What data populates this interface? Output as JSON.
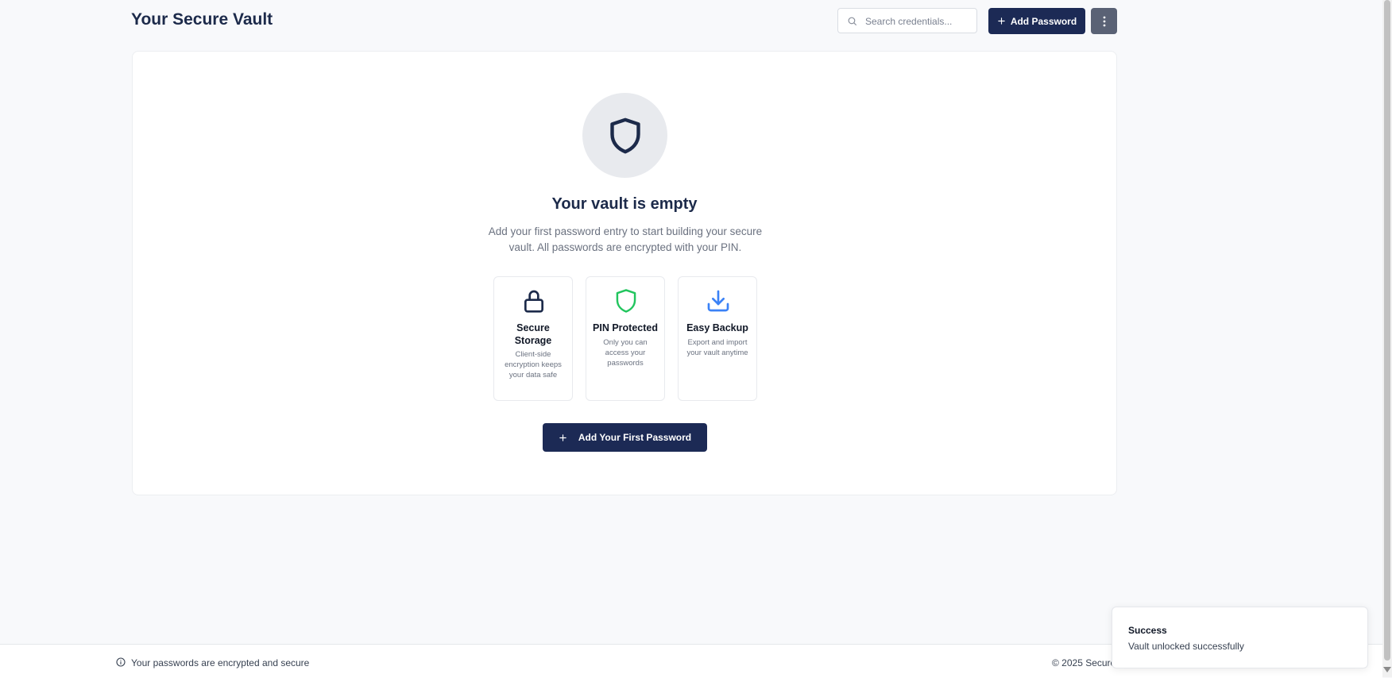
{
  "header": {
    "title": "Your Secure Vault",
    "search_placeholder": "Search credentials...",
    "add_button_label": "Add Password",
    "more_icon": "more-vertical-icon"
  },
  "empty_state": {
    "icon": "shield-icon",
    "title": "Your vault is empty",
    "description": "Add your first password entry to start building your secure vault. All passwords are encrypted with your PIN.",
    "features": [
      {
        "icon": "lock-icon",
        "color": "#1c2a4a",
        "title": "Secure Storage",
        "description": "Client-side encryption keeps your data safe"
      },
      {
        "icon": "shield-icon",
        "color": "#22c55e",
        "title": "PIN Protected",
        "description": "Only you can access your passwords"
      },
      {
        "icon": "download-icon",
        "color": "#3b82f6",
        "title": "Easy Backup",
        "description": "Export and import your vault anytime"
      }
    ],
    "cta_label": "Add Your First Password"
  },
  "footer": {
    "info_icon": "info-icon",
    "security_text": "Your passwords are encrypted and secure",
    "copyright": "© 2025 Secure"
  },
  "toast": {
    "title": "Success",
    "message": "Vault unlocked successfully"
  },
  "colors": {
    "primary": "#1c2a55",
    "background": "#f8f9fb",
    "success": "#22c55e",
    "info": "#3b82f6"
  }
}
